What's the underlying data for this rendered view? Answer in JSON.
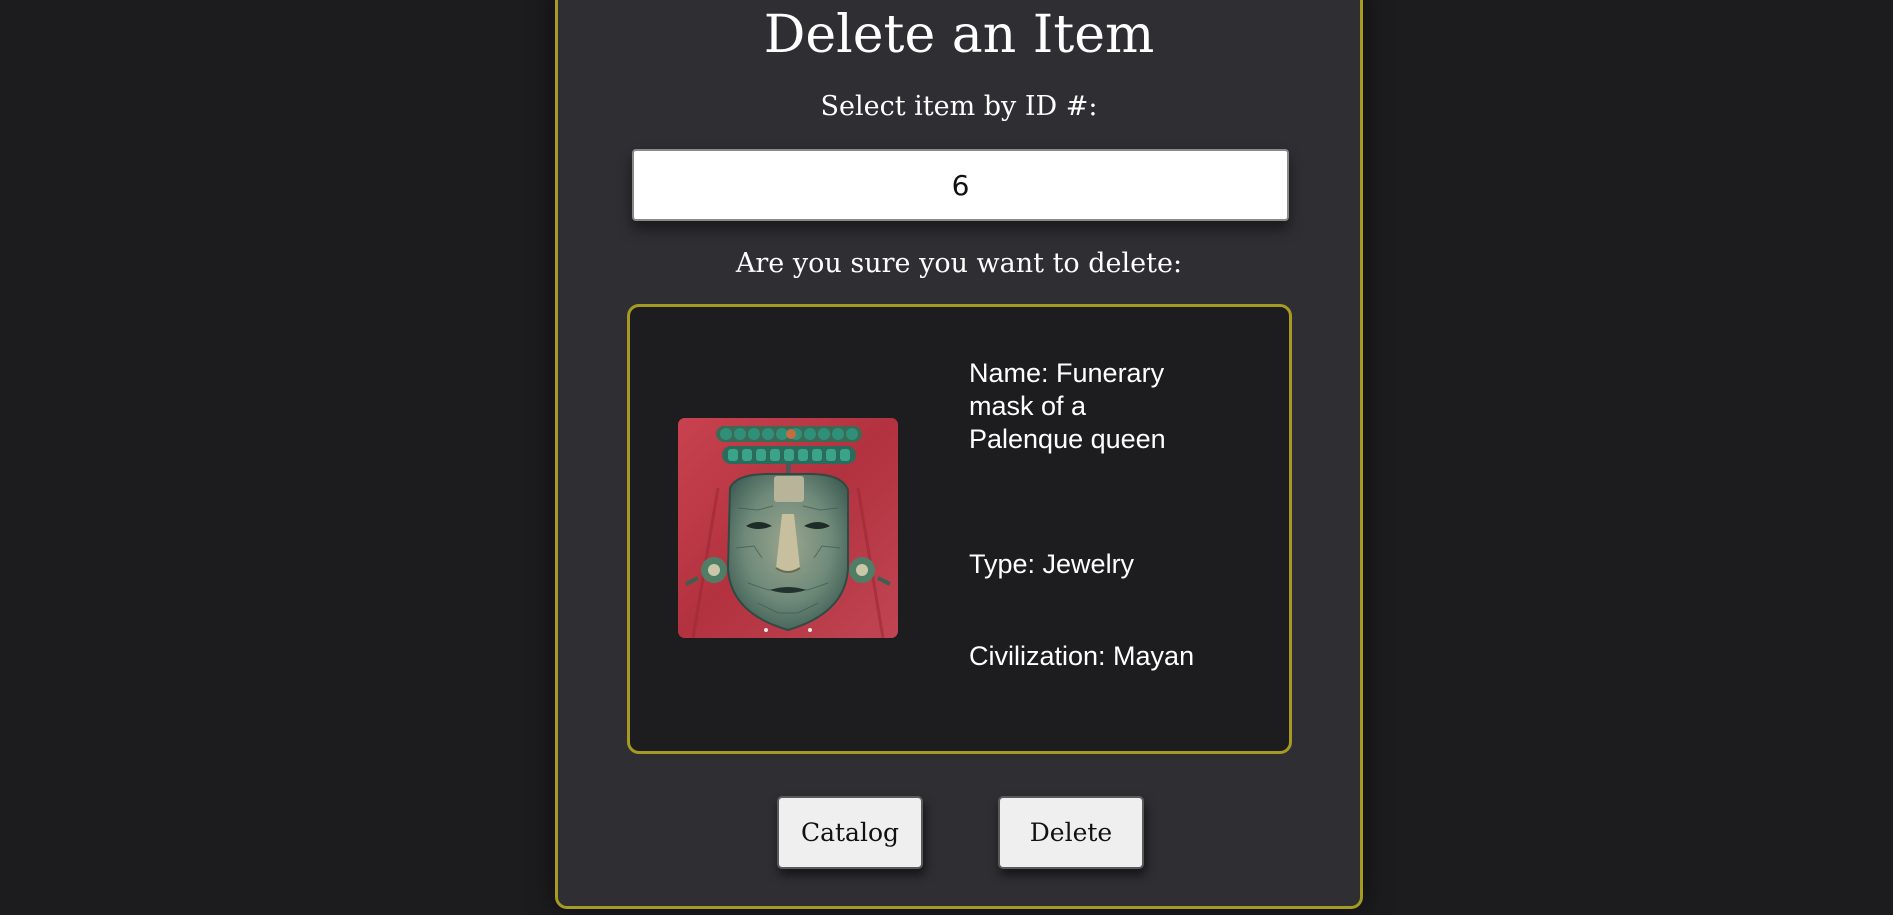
{
  "page": {
    "title": "Delete an Item",
    "select_label": "Select item by ID #:",
    "confirm_label": "Are you sure you want to delete:"
  },
  "id_input": {
    "value": "6",
    "placeholder": ""
  },
  "item": {
    "image_alt": "Funerary mask of a Palenque queen",
    "name_line": "Name: Funerary mask of a Palenque queen",
    "type_line": "Type: Jewelry",
    "civilization_line": "Civilization: Mayan"
  },
  "buttons": {
    "catalog_label": "Catalog",
    "delete_label": "Delete"
  },
  "colors": {
    "background": "#1c1c1e",
    "panel": "#2e2e33",
    "card": "#1d1d1f",
    "accent_border": "#a59a22",
    "image_background": "#b93a45"
  },
  "icons": {
    "item_image": "jade-mask-image"
  }
}
